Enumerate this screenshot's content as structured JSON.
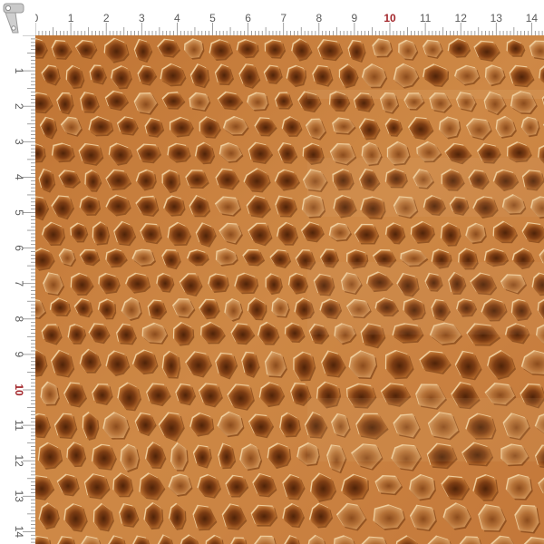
{
  "ruler": {
    "top_labels": [
      "0",
      "1",
      "2",
      "3",
      "4",
      "5",
      "6",
      "7",
      "8",
      "9",
      "10",
      "11",
      "12",
      "13",
      "14"
    ],
    "left_labels": [
      "1",
      "2",
      "3",
      "4",
      "5",
      "6",
      "7",
      "8",
      "9",
      "10",
      "11",
      "12",
      "13",
      "14"
    ],
    "highlight_label": "10",
    "label_color": "#5a5a5a",
    "highlight_color": "#a3262b",
    "tick_color": "#8a8a8a"
  },
  "swatch": {
    "pattern": "crocodile-leather-texture",
    "colors": {
      "base": "#c27a3a",
      "light": "#f0c690",
      "scale_dark": "#5a2a0c",
      "scale_mid": "#9a5420",
      "ridge": "#f6dcb4"
    }
  }
}
